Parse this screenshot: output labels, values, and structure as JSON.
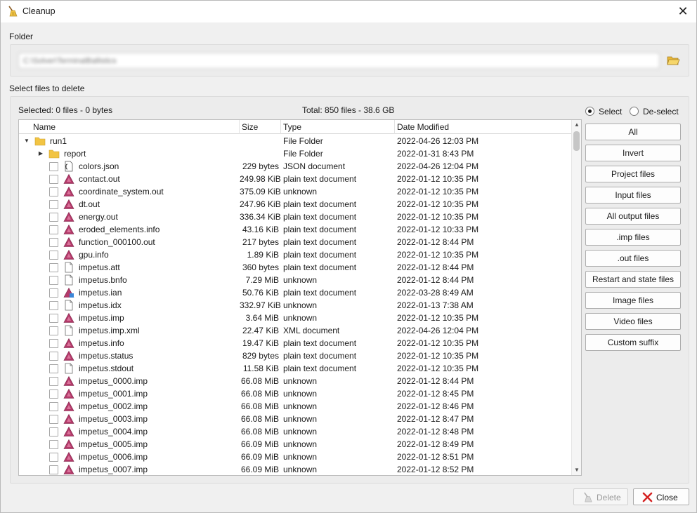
{
  "window": {
    "title": "Cleanup",
    "app_icon": "broom-icon",
    "close_icon": "close-icon"
  },
  "folder": {
    "label": "Folder",
    "path": "C:\\Solver\\TerminalBallistics",
    "browse_icon": "folder-open-icon"
  },
  "files": {
    "label": "Select files to delete",
    "selected": "Selected: 0 files - 0 bytes",
    "total": "Total: 850 files - 38.6 GB",
    "columns": [
      "Name",
      "Size",
      "Type",
      "Date Modified"
    ],
    "rows": [
      {
        "name": "run1",
        "size": "",
        "type": "File Folder",
        "date": "2022-04-26 12:03 PM",
        "level": 0,
        "kind": "folder",
        "expand": "expanded",
        "checkbox": false
      },
      {
        "name": "report",
        "size": "",
        "type": "File Folder",
        "date": "2022-01-31 8:43 PM",
        "level": 1,
        "kind": "folder",
        "expand": "collapsed",
        "checkbox": false
      },
      {
        "name": "colors.json",
        "size": "229 bytes",
        "type": "JSON document",
        "date": "2022-04-26 12:04 PM",
        "level": 1,
        "kind": "json",
        "checkbox": true
      },
      {
        "name": "contact.out",
        "size": "249.98 KiB",
        "type": "plain text document",
        "date": "2022-01-12 10:35 PM",
        "level": 1,
        "kind": "impetus",
        "checkbox": true
      },
      {
        "name": "coordinate_system.out",
        "size": "375.09 KiB",
        "type": "unknown",
        "date": "2022-01-12 10:35 PM",
        "level": 1,
        "kind": "impetus",
        "checkbox": true
      },
      {
        "name": "dt.out",
        "size": "247.96 KiB",
        "type": "plain text document",
        "date": "2022-01-12 10:35 PM",
        "level": 1,
        "kind": "impetus",
        "checkbox": true
      },
      {
        "name": "energy.out",
        "size": "336.34 KiB",
        "type": "plain text document",
        "date": "2022-01-12 10:35 PM",
        "level": 1,
        "kind": "impetus",
        "checkbox": true
      },
      {
        "name": "eroded_elements.info",
        "size": "43.16 KiB",
        "type": "plain text document",
        "date": "2022-01-12 10:33 PM",
        "level": 1,
        "kind": "impetus",
        "checkbox": true
      },
      {
        "name": "function_000100.out",
        "size": "217 bytes",
        "type": "plain text document",
        "date": "2022-01-12 8:44 PM",
        "level": 1,
        "kind": "impetus",
        "checkbox": true
      },
      {
        "name": "gpu.info",
        "size": "1.89 KiB",
        "type": "plain text document",
        "date": "2022-01-12 10:35 PM",
        "level": 1,
        "kind": "impetus",
        "checkbox": true
      },
      {
        "name": "impetus.att",
        "size": "360 bytes",
        "type": "plain text document",
        "date": "2022-01-12 8:44 PM",
        "level": 1,
        "kind": "file",
        "checkbox": true
      },
      {
        "name": "impetus.bnfo",
        "size": "7.29 MiB",
        "type": "unknown",
        "date": "2022-01-12 8:44 PM",
        "level": 1,
        "kind": "file",
        "checkbox": true
      },
      {
        "name": "impetus.ian",
        "size": "50.76 KiB",
        "type": "plain text document",
        "date": "2022-03-28 8:49 AM",
        "level": 1,
        "kind": "impetus-blue",
        "checkbox": true
      },
      {
        "name": "impetus.idx",
        "size": "332.97 KiB",
        "type": "unknown",
        "date": "2022-01-13 7:38 AM",
        "level": 1,
        "kind": "file",
        "checkbox": true
      },
      {
        "name": "impetus.imp",
        "size": "3.64 MiB",
        "type": "unknown",
        "date": "2022-01-12 10:35 PM",
        "level": 1,
        "kind": "impetus",
        "checkbox": true
      },
      {
        "name": "impetus.imp.xml",
        "size": "22.47 KiB",
        "type": "XML document",
        "date": "2022-04-26 12:04 PM",
        "level": 1,
        "kind": "file",
        "checkbox": true
      },
      {
        "name": "impetus.info",
        "size": "19.47 KiB",
        "type": "plain text document",
        "date": "2022-01-12 10:35 PM",
        "level": 1,
        "kind": "impetus",
        "checkbox": true
      },
      {
        "name": "impetus.status",
        "size": "829 bytes",
        "type": "plain text document",
        "date": "2022-01-12 10:35 PM",
        "level": 1,
        "kind": "impetus",
        "checkbox": true
      },
      {
        "name": "impetus.stdout",
        "size": "11.58 KiB",
        "type": "plain text document",
        "date": "2022-01-12 10:35 PM",
        "level": 1,
        "kind": "file",
        "checkbox": true
      },
      {
        "name": "impetus_0000.imp",
        "size": "66.08 MiB",
        "type": "unknown",
        "date": "2022-01-12 8:44 PM",
        "level": 1,
        "kind": "impetus",
        "checkbox": true
      },
      {
        "name": "impetus_0001.imp",
        "size": "66.08 MiB",
        "type": "unknown",
        "date": "2022-01-12 8:45 PM",
        "level": 1,
        "kind": "impetus",
        "checkbox": true
      },
      {
        "name": "impetus_0002.imp",
        "size": "66.08 MiB",
        "type": "unknown",
        "date": "2022-01-12 8:46 PM",
        "level": 1,
        "kind": "impetus",
        "checkbox": true
      },
      {
        "name": "impetus_0003.imp",
        "size": "66.08 MiB",
        "type": "unknown",
        "date": "2022-01-12 8:47 PM",
        "level": 1,
        "kind": "impetus",
        "checkbox": true
      },
      {
        "name": "impetus_0004.imp",
        "size": "66.08 MiB",
        "type": "unknown",
        "date": "2022-01-12 8:48 PM",
        "level": 1,
        "kind": "impetus",
        "checkbox": true
      },
      {
        "name": "impetus_0005.imp",
        "size": "66.09 MiB",
        "type": "unknown",
        "date": "2022-01-12 8:49 PM",
        "level": 1,
        "kind": "impetus",
        "checkbox": true
      },
      {
        "name": "impetus_0006.imp",
        "size": "66.09 MiB",
        "type": "unknown",
        "date": "2022-01-12 8:51 PM",
        "level": 1,
        "kind": "impetus",
        "checkbox": true
      },
      {
        "name": "impetus_0007.imp",
        "size": "66.09 MiB",
        "type": "unknown",
        "date": "2022-01-12 8:52 PM",
        "level": 1,
        "kind": "impetus",
        "checkbox": true
      }
    ]
  },
  "selection_mode": {
    "select": "Select",
    "deselect": "De-select",
    "selected": "select"
  },
  "side_buttons": [
    "All",
    "Invert",
    "Project files",
    "Input files",
    "All output files",
    ".imp files",
    ".out files",
    "Restart and state files",
    "Image files",
    "Video files",
    "Custom suffix"
  ],
  "footer": {
    "delete": "Delete",
    "delete_icon": "broom-icon",
    "close": "Close",
    "close_icon": "red-x-icon"
  },
  "colors": {
    "impetus_icon": "#b43a6a",
    "folder_icon": "#f2c443",
    "close_x": "#d42020"
  }
}
